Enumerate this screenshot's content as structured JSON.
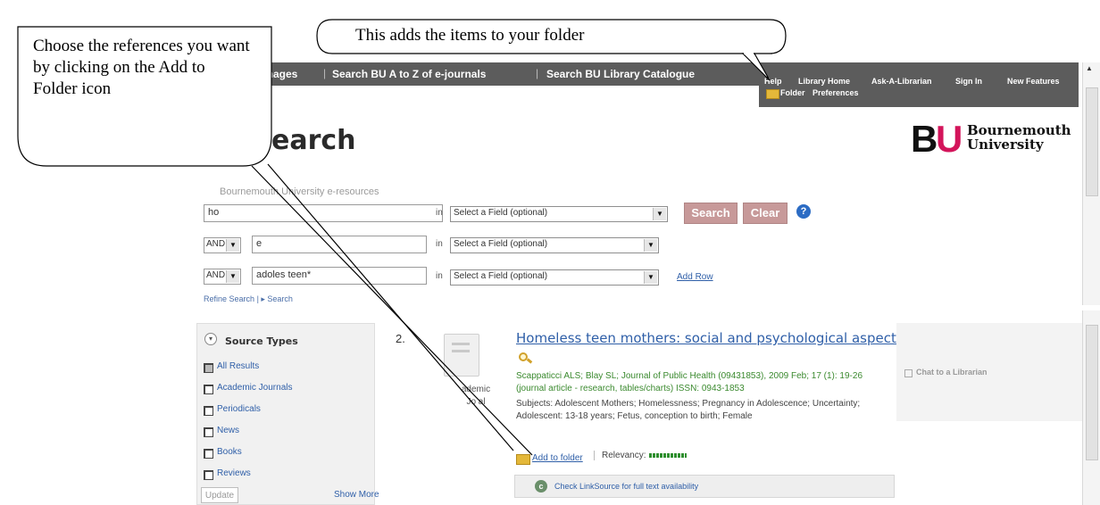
{
  "callouts": {
    "folder_tip": "This adds the items to your folder",
    "choose_tip": "Choose the references you want by clicking on the Add to Folder icon"
  },
  "nav": {
    "links": [
      "Images",
      "Search BU A to Z of e-journals",
      "Search BU Library Catalogue"
    ],
    "right_links": [
      "Help",
      "Library Home",
      "Ask-A-Librarian",
      "Sign In",
      "New Features"
    ],
    "folder": "Folder",
    "preferences": "Preferences"
  },
  "header": {
    "title": "earch",
    "logo_mark": "BU",
    "logo_line1": "Bournemouth",
    "logo_line2": "University"
  },
  "search": {
    "searching_label": "Bournemouth University e-resources",
    "in_label": "in",
    "rows": [
      {
        "bool": "",
        "value": "ho",
        "field": "Select a Field (optional)"
      },
      {
        "bool": "AND",
        "value": "e",
        "field": "Select a Field (optional)"
      },
      {
        "bool": "AND",
        "value": "adoles       teen*",
        "field": "Select a Field (optional)"
      }
    ],
    "search_btn": "Search",
    "clear_btn": "Clear",
    "add_row": "Add Row",
    "refine": "Refine Search",
    "search_history": "Search"
  },
  "sidebar": {
    "heading": "Source Types",
    "items": [
      {
        "label": "All Results",
        "checked": true
      },
      {
        "label": "Academic Journals",
        "checked": false
      },
      {
        "label": "Periodicals",
        "checked": false
      },
      {
        "label": "News",
        "checked": false
      },
      {
        "label": "Books",
        "checked": false
      },
      {
        "label": "Reviews",
        "checked": false
      }
    ],
    "update": "Update",
    "show_more": "Show More"
  },
  "result": {
    "number": "2.",
    "title": "Homeless teen mothers: social and psychological aspects.",
    "meta": "Scappaticci ALS; Blay SL; Journal of Public Health (09431853), 2009 Feb; 17 (1): 19-26 (journal article - research, tables/charts) ISSN: 0943-1853",
    "subjects": "Subjects: Adolescent Mothers; Homelessness; Pregnancy in Adolescence; Uncertainty; Adolescent: 13-18 years; Fetus, conception to birth; Female",
    "doc_type_line1": "ademic",
    "doc_type_line2": "Jo   al",
    "add_folder": "Add to folder",
    "relevancy_label": "Relevancy:",
    "linksource": "Check LinkSource for full text availability"
  },
  "chat": "Chat to a Librarian"
}
